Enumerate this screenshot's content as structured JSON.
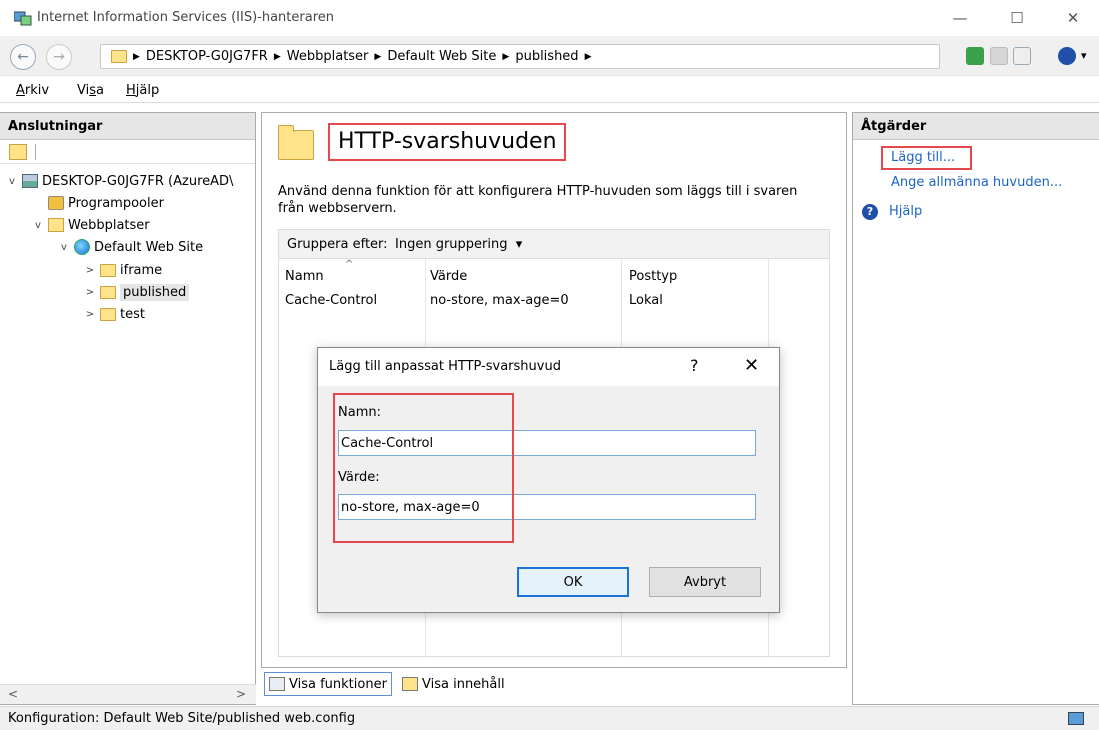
{
  "window": {
    "title": "Internet Information Services (IIS)-hanteraren",
    "minimize": "—",
    "maximize": "☐",
    "close": "✕"
  },
  "address": {
    "back": "←",
    "forward": "→",
    "crumbs": [
      "DESKTOP-G0JG7FR",
      "Webbplatser",
      "Default Web Site",
      "published"
    ],
    "arrow": "▶",
    "help_dropdown": "▾"
  },
  "menu": {
    "arkiv_prefix": "A",
    "arkiv_rest": "rkiv",
    "visa_prefix": "Vi",
    "visa_u": "s",
    "visa_rest": "a",
    "hjalp_prefix": "H",
    "hjalp_rest": "jälp"
  },
  "connections": {
    "header": "Anslutningar",
    "tree": [
      {
        "label": "DESKTOP-G0JG7FR (AzureAD\\",
        "twisty": "v"
      },
      {
        "label": "Programpooler",
        "twisty": ""
      },
      {
        "label": "Webbplatser",
        "twisty": "v"
      },
      {
        "label": "Default Web Site",
        "twisty": "v"
      },
      {
        "label": "iframe",
        "twisty": ">"
      },
      {
        "label": "published",
        "twisty": ">"
      },
      {
        "label": "test",
        "twisty": ">"
      }
    ],
    "scroll_left": "<",
    "scroll_right": ">"
  },
  "feature": {
    "title": "HTTP-svarshuvuden",
    "description_line1": "Använd denna funktion för att konfigurera HTTP-huvuden som läggs till i svaren",
    "description_line2": "från webbservern.",
    "group_label": "Gruppera efter:",
    "group_value": "Ingen gruppering",
    "group_caret": "▾",
    "sort_caret": "^",
    "columns": [
      "Namn",
      "Värde",
      "Posttyp"
    ],
    "rows": [
      {
        "name": "Cache-Control",
        "value": "no-store, max-age=0",
        "type": "Lokal"
      }
    ]
  },
  "view_tabs": {
    "features": "Visa funktioner",
    "content": "Visa innehåll"
  },
  "actions": {
    "header": "Åtgärder",
    "add": "Lägg till...",
    "set_common": "Ange allmänna huvuden...",
    "help": "Hjälp",
    "help_glyph": "?"
  },
  "dialog": {
    "title": "Lägg till anpassat HTTP-svarshuvud",
    "help": "?",
    "close": "✕",
    "name_label": "Namn:",
    "name_value": "Cache-Control",
    "value_label": "Värde:",
    "value_value": "no-store, max-age=0",
    "ok": "OK",
    "cancel": "Avbryt"
  },
  "status": {
    "text": "Konfiguration: Default Web Site/published web.config"
  },
  "colors": {
    "highlight": "#e5484d",
    "link": "#1c63c7"
  }
}
